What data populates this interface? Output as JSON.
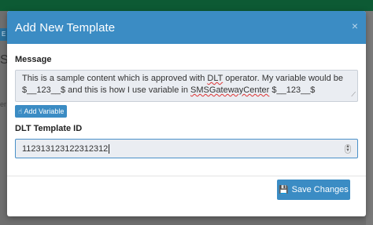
{
  "background": {
    "edge_label": "E",
    "edge_letter": "S",
    "edge_text": "er"
  },
  "modal": {
    "title": "Add New Template",
    "close_icon": "×",
    "message_label": "Message",
    "message_text_part1": "This is a sample content which is approved with ",
    "message_text_dlt": "DLT",
    "message_text_part2": "  operator. My variable would be $__123__$ and  this is how I use variable in ",
    "message_text_brand": "SMSGatewayCenter",
    "message_text_part3": " $__123__$",
    "add_variable_label": "Add Variable",
    "dlt_label": "DLT Template ID",
    "dlt_value": "1123131231223123​12",
    "save_label": "Save Changes"
  },
  "colors": {
    "header": "#3b8cc4",
    "primary_button": "#3b8cc4",
    "topbar": "#0d5a34"
  },
  "icons": {
    "hand": "hand-pointer-icon",
    "save": "floppy-disk-icon",
    "close": "close-icon"
  }
}
